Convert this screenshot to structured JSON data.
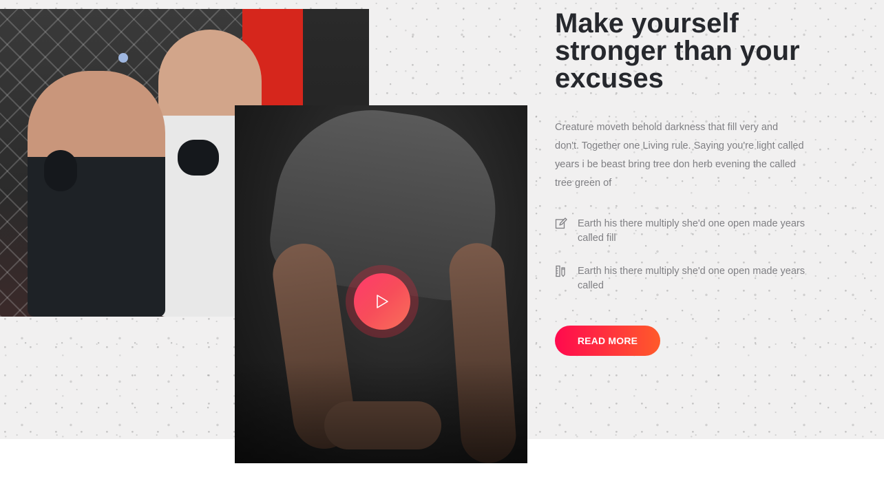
{
  "about": {
    "title": "Make yourself stronger than your excuses",
    "description": "Creature moveth behold darkness that fill very and don't. Together one Living rule. Saying you're light called years i be beast bring tree don herb evening the called tree green of",
    "features": [
      {
        "icon": "edit-icon",
        "text": "Earth his there multiply she'd one open made years called fill"
      },
      {
        "icon": "ruler-pencil-icon",
        "text": "Earth his there multiply she'd one open made years called"
      }
    ],
    "read_more_label": "READ MORE"
  },
  "media": {
    "boxing_photo": "boxing-training-photo",
    "stretch_photo": "stretching-video-thumbnail",
    "play_icon": "play-icon"
  },
  "colors": {
    "accent_start": "#ff0a4e",
    "accent_end": "#ff5a2a",
    "title": "#26282d",
    "body_text": "#7f7f83",
    "background": "#f1f0f0"
  }
}
